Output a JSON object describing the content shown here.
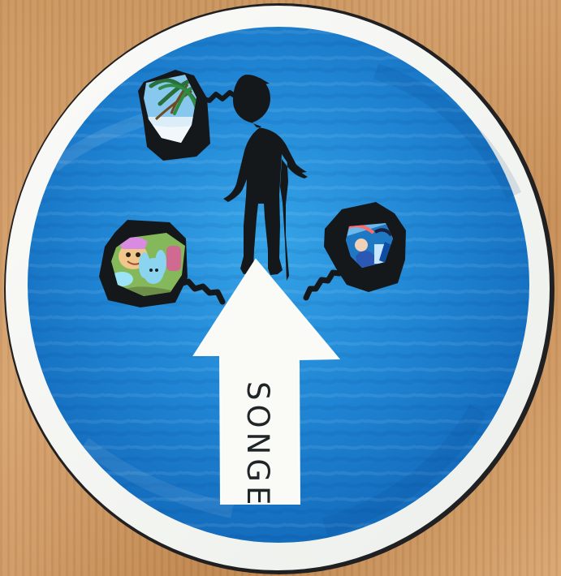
{
  "artwork": {
    "arrow_word": "SONGE",
    "colors": {
      "background_wood": "#c99158",
      "plate_rim": "#f3f5f1",
      "painted_circle": "#1e85d3",
      "silhouette": "#15181b",
      "arrow": "#fafaf7"
    },
    "icons": [
      "palm-tree-photo-icon",
      "cartoon-photo-icon",
      "fantasy-photo-icon",
      "person-silhouette-icon",
      "arrow-icon"
    ]
  }
}
